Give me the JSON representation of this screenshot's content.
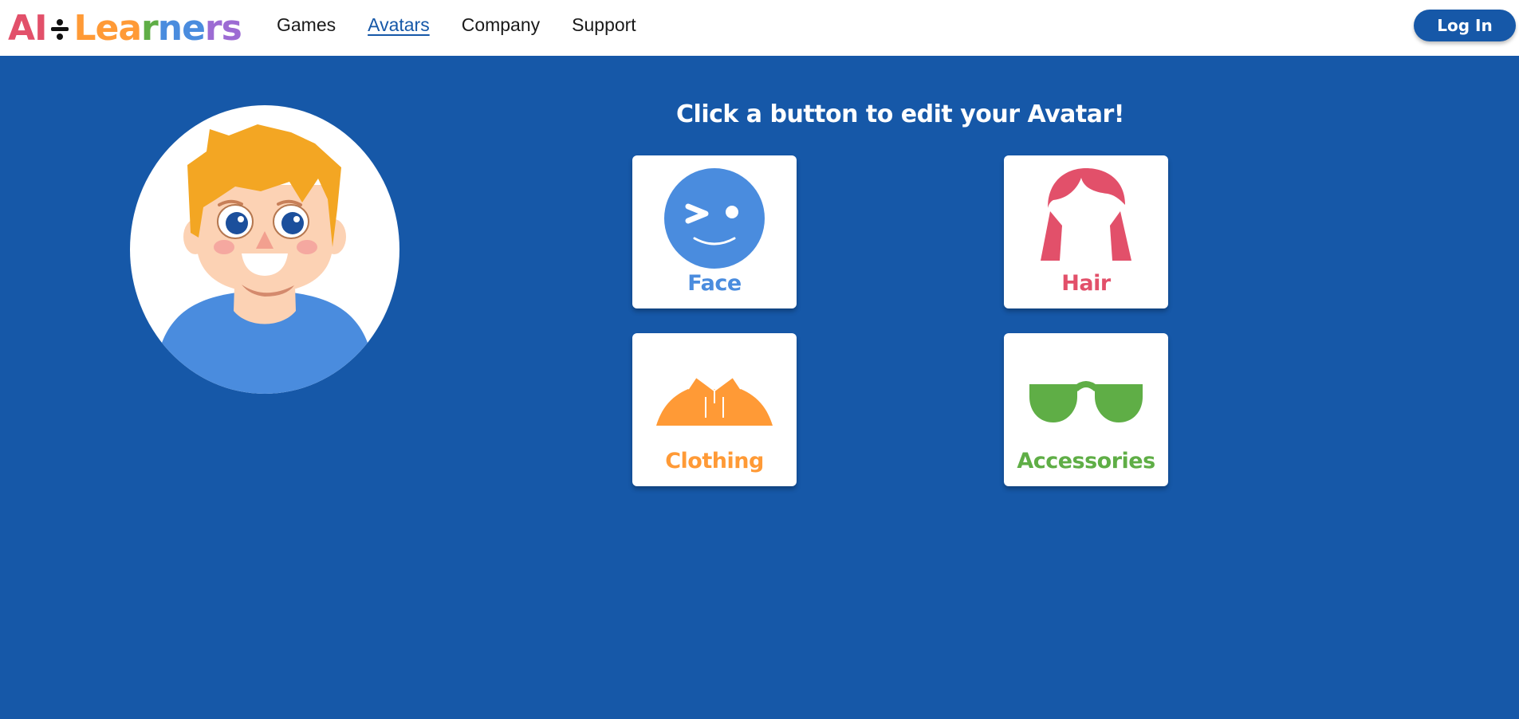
{
  "header": {
    "logo": {
      "parts": [
        "A",
        "I",
        "L",
        "e",
        "a",
        "r",
        "n",
        "e",
        "r",
        "s"
      ]
    },
    "nav": [
      {
        "label": "Games",
        "active": false
      },
      {
        "label": "Avatars",
        "active": true
      },
      {
        "label": "Company",
        "active": false
      },
      {
        "label": "Support",
        "active": false
      }
    ],
    "login_label": "Log In"
  },
  "main": {
    "heading": "Click a button to edit your Avatar!",
    "tiles": [
      {
        "label": "Face",
        "icon": "winking-face-icon",
        "color": "#4a8cde"
      },
      {
        "label": "Hair",
        "icon": "hair-icon",
        "color": "#e2506a"
      },
      {
        "label": "Clothing",
        "icon": "shirt-icon",
        "color": "#ff9a36"
      },
      {
        "label": "Accessories",
        "icon": "sunglasses-icon",
        "color": "#5fae46"
      }
    ]
  },
  "colors": {
    "background": "#1658a8",
    "header_bg": "#ffffff",
    "link_active": "#1658a8",
    "button_bg": "#1658a8",
    "logo": [
      "#e2506a",
      "#e2506a",
      "#ff9a36",
      "#ff9a36",
      "#ff9a36",
      "#5fae46",
      "#4a8cde",
      "#4a8cde",
      "#9c6bd3",
      "#9c6bd3"
    ]
  }
}
